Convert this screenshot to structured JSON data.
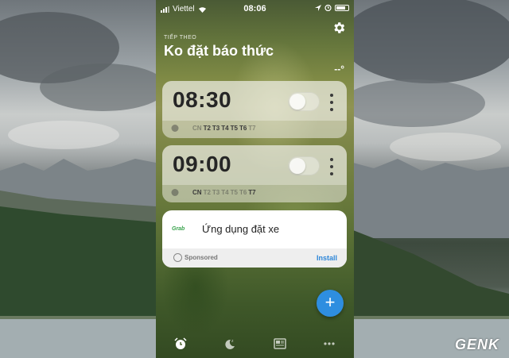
{
  "status_bar": {
    "carrier": "Viettel",
    "time": "08:06"
  },
  "header": {
    "next_label": "TIẾP THEO",
    "next_title": "Ko đặt báo thức",
    "weather": "--°"
  },
  "alarms": [
    {
      "time": "08:30",
      "enabled": false,
      "days": [
        {
          "label": "CN",
          "active": false
        },
        {
          "label": "T2",
          "active": true
        },
        {
          "label": "T3",
          "active": true
        },
        {
          "label": "T4",
          "active": true
        },
        {
          "label": "T5",
          "active": true
        },
        {
          "label": "T6",
          "active": true
        },
        {
          "label": "T7",
          "active": false
        }
      ]
    },
    {
      "time": "09:00",
      "enabled": false,
      "days": [
        {
          "label": "CN",
          "active": true
        },
        {
          "label": "T2",
          "active": false
        },
        {
          "label": "T3",
          "active": false
        },
        {
          "label": "T4",
          "active": false
        },
        {
          "label": "T5",
          "active": false
        },
        {
          "label": "T6",
          "active": false
        },
        {
          "label": "T7",
          "active": true
        }
      ]
    }
  ],
  "ad": {
    "brand": "Grab",
    "title": "Ứng dụng đặt xe",
    "sponsored_label": "Sponsored",
    "install_label": "Install"
  },
  "fab_label": "+",
  "tabs": [
    {
      "icon": "alarm-icon",
      "active": true
    },
    {
      "icon": "sleep-icon",
      "active": false
    },
    {
      "icon": "news-icon",
      "active": false
    },
    {
      "icon": "more-icon",
      "active": false
    }
  ],
  "watermark": "GENK",
  "colors": {
    "accent": "#2e8ee0",
    "install": "#2d86d8",
    "grab_green": "#3aa34d"
  }
}
